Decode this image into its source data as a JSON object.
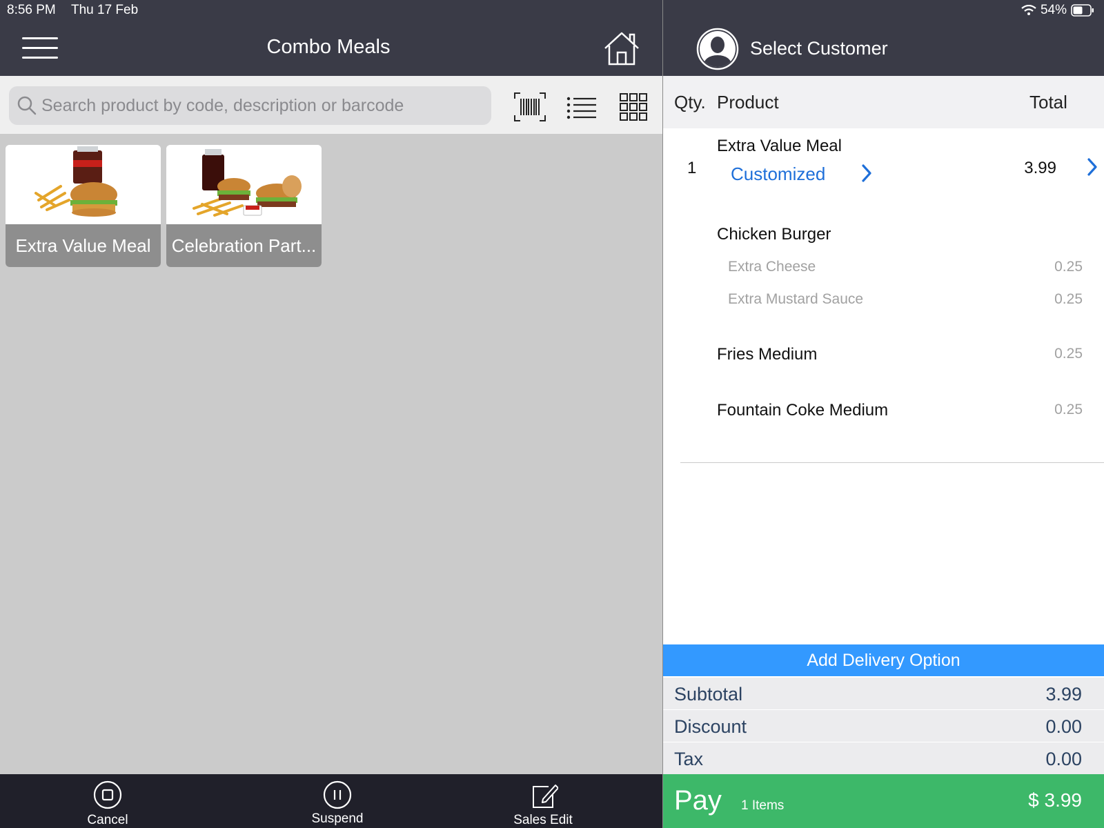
{
  "status_bar": {
    "time": "8:56 PM",
    "date": "Thu 17 Feb",
    "battery": "54%"
  },
  "header": {
    "title": "Combo Meals"
  },
  "search": {
    "placeholder": "Search product by code, description or barcode"
  },
  "products": [
    {
      "name": "Extra Value Meal"
    },
    {
      "name": "Celebration Part..."
    }
  ],
  "bottom_bar": {
    "cancel": "Cancel",
    "suspend": "Suspend",
    "sales_edit": "Sales Edit"
  },
  "customer": {
    "label": "Select Customer"
  },
  "cart": {
    "columns": {
      "qty": "Qty.",
      "product": "Product",
      "total": "Total"
    },
    "line": {
      "qty": "1",
      "name": "Extra Value Meal",
      "customized": "Customized",
      "total": "3.99",
      "components": [
        {
          "name": "Chicken Burger",
          "price": ""
        },
        {
          "name": "Fries Medium",
          "price": "0.25"
        },
        {
          "name": "Fountain Coke Medium",
          "price": "0.25"
        }
      ],
      "modifiers": [
        {
          "name": "Extra Cheese",
          "price": "0.25"
        },
        {
          "name": "Extra Mustard Sauce",
          "price": "0.25"
        }
      ]
    }
  },
  "delivery": {
    "label": "Add Delivery Option"
  },
  "summary": {
    "subtotal_label": "Subtotal",
    "subtotal": "3.99",
    "discount_label": "Discount",
    "discount": "0.00",
    "tax_label": "Tax",
    "tax": "0.00"
  },
  "pay": {
    "label": "Pay",
    "items": "1 Items",
    "total": "$ 3.99"
  },
  "colors": {
    "header": "#3a3b47",
    "accent_blue": "#3399ff",
    "link_blue": "#1e6fd9",
    "pay_green": "#3db869",
    "tile_label": "#8e8e8e"
  }
}
